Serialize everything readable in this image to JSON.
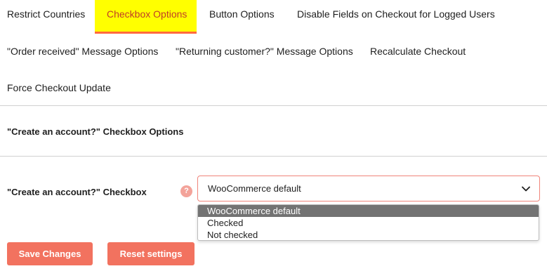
{
  "tabs": [
    {
      "label": "Restrict Countries",
      "active": false
    },
    {
      "label": "Checkbox Options",
      "active": true
    },
    {
      "label": "Button Options",
      "active": false
    },
    {
      "label": "Disable Fields on Checkout for Logged Users",
      "active": false
    },
    {
      "label": "\"Order received\" Message Options",
      "active": false
    },
    {
      "label": "\"Returning customer?\" Message Options",
      "active": false
    },
    {
      "label": "Recalculate Checkout",
      "active": false
    },
    {
      "label": "Force Checkout Update",
      "active": false
    }
  ],
  "section": {
    "title": "\"Create an account?\" Checkbox Options"
  },
  "field": {
    "label": "\"Create an account?\" Checkbox",
    "help_icon": "?",
    "select_value": "WooCommerce default",
    "options": [
      "WooCommerce default",
      "Checked",
      "Not checked"
    ],
    "selected_index": 0
  },
  "buttons": {
    "save_label": "Save Changes",
    "reset_label": "Reset settings"
  },
  "colors": {
    "active_tab_bg": "#ffff00",
    "active_tab_text": "#c03d28",
    "button_bg": "#f2725f",
    "select_border": "#f0847a",
    "option_selected_bg": "#737373"
  },
  "icons": {
    "help": "question-circle-icon",
    "dropdown": "chevron-down-icon"
  }
}
